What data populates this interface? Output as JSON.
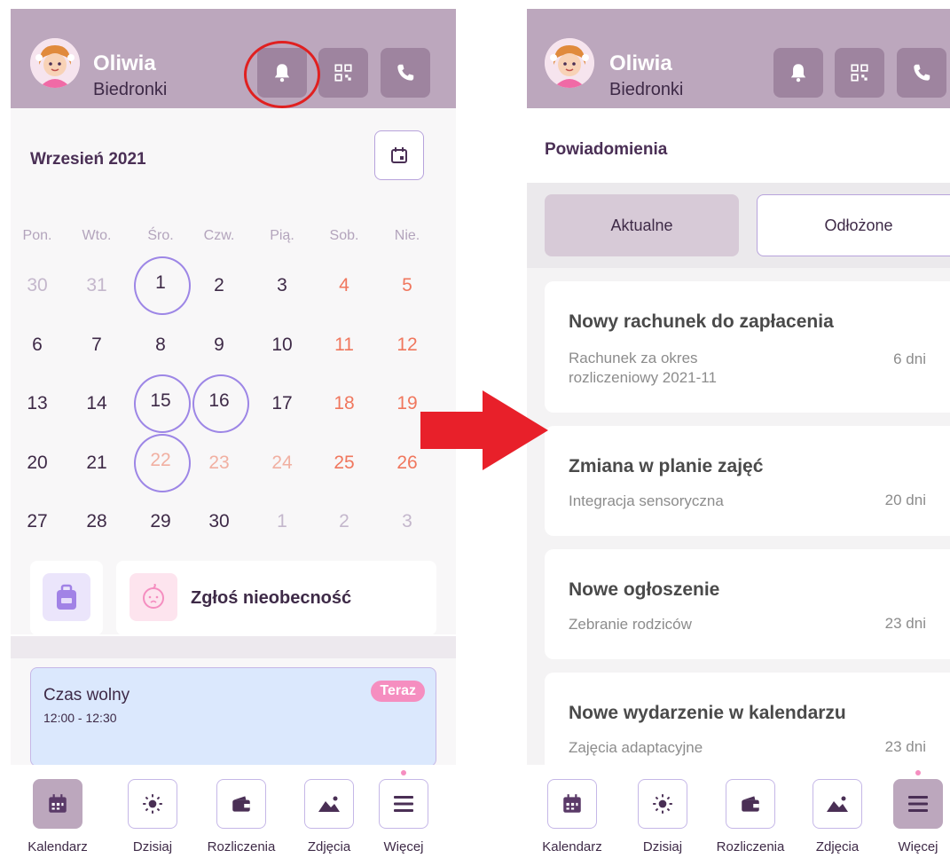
{
  "left": {
    "header": {
      "name": "Oliwia",
      "group": "Biedronki"
    },
    "month": "Wrzesień 2021",
    "weekdays": [
      "Pon.",
      "Wto.",
      "Śro.",
      "Czw.",
      "Pią.",
      "Sob.",
      "Nie."
    ],
    "weeks": [
      [
        "30",
        "31",
        "1",
        "2",
        "3",
        "4",
        "5"
      ],
      [
        "6",
        "7",
        "8",
        "9",
        "10",
        "11",
        "12"
      ],
      [
        "13",
        "14",
        "15",
        "16",
        "17",
        "18",
        "19"
      ],
      [
        "20",
        "21",
        "22",
        "23",
        "24",
        "25",
        "26"
      ],
      [
        "27",
        "28",
        "29",
        "30",
        "1",
        "2",
        "3"
      ]
    ],
    "absence_label": "Zgłoś nieobecność",
    "event": {
      "title": "Czas wolny",
      "time": "12:00 - 12:30",
      "badge": "Teraz"
    }
  },
  "right": {
    "header": {
      "name": "Oliwia",
      "group": "Biedronki"
    },
    "title": "Powiadomienia",
    "segments": {
      "current": "Aktualne",
      "postponed": "Odłożone"
    },
    "notifications": [
      {
        "title": "Nowy rachunek do zapłacenia",
        "subtitle_line1": "Rachunek za okres",
        "subtitle_line2": "rozliczeniowy 2021-11",
        "age": "6 dni"
      },
      {
        "title": "Zmiana w planie zajęć",
        "subtitle_line1": "Integracja sensoryczna",
        "age": "20 dni"
      },
      {
        "title": "Nowe ogłoszenie",
        "subtitle_line1": "Zebranie rodziców",
        "age": "23 dni"
      },
      {
        "title": "Nowe wydarzenie w kalendarzu",
        "subtitle_line1": "Zajęcia adaptacyjne",
        "age": "23 dni"
      }
    ]
  },
  "tabbar": {
    "tabs": [
      {
        "label": "Kalendarz",
        "icon": "calendar-icon"
      },
      {
        "label": "Dzisiaj",
        "icon": "sun-icon"
      },
      {
        "label": "Rozliczenia",
        "icon": "wallet-icon"
      },
      {
        "label": "Zdjęcia",
        "icon": "image-icon"
      },
      {
        "label": "Więcej",
        "icon": "menu-icon"
      }
    ]
  },
  "colors": {
    "header": "#bca7bd",
    "header_button": "#9e849f",
    "accent_ring": "#9d86e6",
    "weekend": "#f0775e",
    "badge": "#f58ec0",
    "highlight": "#e02020"
  }
}
